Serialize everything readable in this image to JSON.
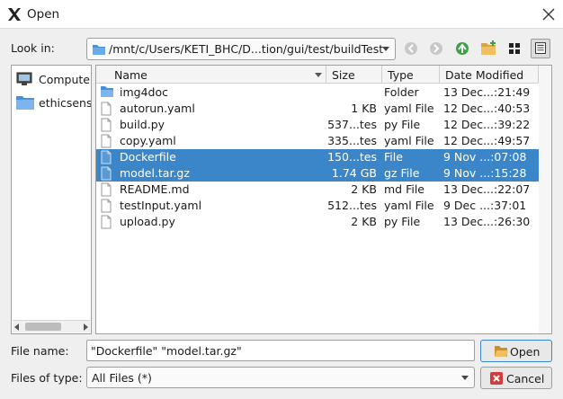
{
  "window": {
    "title": "Open"
  },
  "look_in": {
    "label": "Look in:",
    "path": "/mnt/c/Users/KETI_BHC/D...tion/gui/test/buildTest"
  },
  "toolbar": {
    "icons": [
      "back-icon",
      "forward-icon",
      "parent-dir-icon",
      "new-folder-icon",
      "list-view-icon",
      "detail-view-icon"
    ],
    "active_view": "detail-view"
  },
  "sidebar": {
    "items": [
      {
        "label": "Computer",
        "icon": "computer-icon"
      },
      {
        "label": "ethicsens",
        "icon": "folder-icon"
      }
    ]
  },
  "file_list": {
    "columns": [
      "Name",
      "Size",
      "Type",
      "Date Modified"
    ],
    "rows": [
      {
        "name": "img4doc",
        "size": "",
        "type": "Folder",
        "date": "13 Dec...:21:49",
        "icon": "folder-icon",
        "selected": false
      },
      {
        "name": "autorun.yaml",
        "size": "1 KB",
        "type": "yaml File",
        "date": "12 Dec...:40:53",
        "icon": "file-icon",
        "selected": false
      },
      {
        "name": "build.py",
        "size": "537...tes",
        "type": "py File",
        "date": "12 Dec...:39:22",
        "icon": "file-icon",
        "selected": false
      },
      {
        "name": "copy.yaml",
        "size": "335...tes",
        "type": "yaml File",
        "date": "12 Dec...:49:57",
        "icon": "file-icon",
        "selected": false
      },
      {
        "name": "Dockerfile",
        "size": "150...tes",
        "type": "File",
        "date": "9 Nov ...:07:08",
        "icon": "file-icon",
        "selected": true
      },
      {
        "name": "model.tar.gz",
        "size": "1.74 GB",
        "type": "gz File",
        "date": "9 Nov ...:15:28",
        "icon": "file-icon",
        "selected": true
      },
      {
        "name": "README.md",
        "size": "2 KB",
        "type": "md File",
        "date": "13 Dec...:22:07",
        "icon": "file-icon",
        "selected": false
      },
      {
        "name": "testInput.yaml",
        "size": "512...tes",
        "type": "yaml File",
        "date": "9 Dec ...:37:01",
        "icon": "file-icon",
        "selected": false
      },
      {
        "name": "upload.py",
        "size": "2 KB",
        "type": "py File",
        "date": "13 Dec...:26:30",
        "icon": "file-icon",
        "selected": false
      }
    ]
  },
  "file_name": {
    "label": "File name:",
    "value": "\"Dockerfile\" \"model.tar.gz\""
  },
  "file_type": {
    "label": "Files of type:",
    "value": "All Files (*)"
  },
  "buttons": {
    "open": "Open",
    "cancel": "Cancel"
  },
  "colors": {
    "selection": "#3b86c8",
    "folder": "#4a90d9",
    "ok_green": "#3aa145",
    "cancel_red": "#d23c3c"
  }
}
